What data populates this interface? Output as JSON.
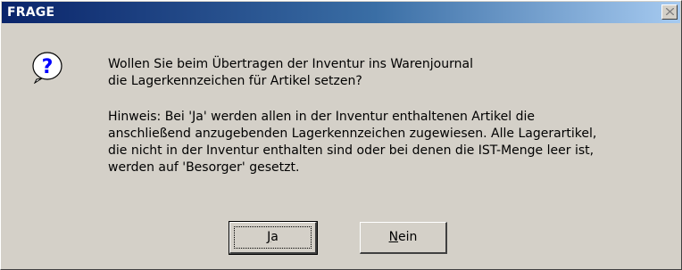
{
  "window": {
    "title": "FRAGE",
    "close_icon": "close-icon"
  },
  "message": {
    "icon": "question-icon",
    "question_lines": [
      "Wollen Sie beim Übertragen der Inventur ins Warenjournal",
      "die Lagerkennzeichen für Artikel setzen?"
    ],
    "hint_lines": [
      "Hinweis: Bei 'Ja' werden allen in der Inventur enthaltenen Artikel die",
      "anschließend anzugebenden Lagerkennzeichen zugewiesen. Alle Lagerartikel,",
      "die nicht in der Inventur enthalten sind oder bei denen die IST-Menge leer ist,",
      "werden auf 'Besorger' gesetzt."
    ]
  },
  "buttons": {
    "yes": {
      "mnemonic": "J",
      "rest": "a"
    },
    "no": {
      "mnemonic": "N",
      "rest": "ein"
    }
  }
}
